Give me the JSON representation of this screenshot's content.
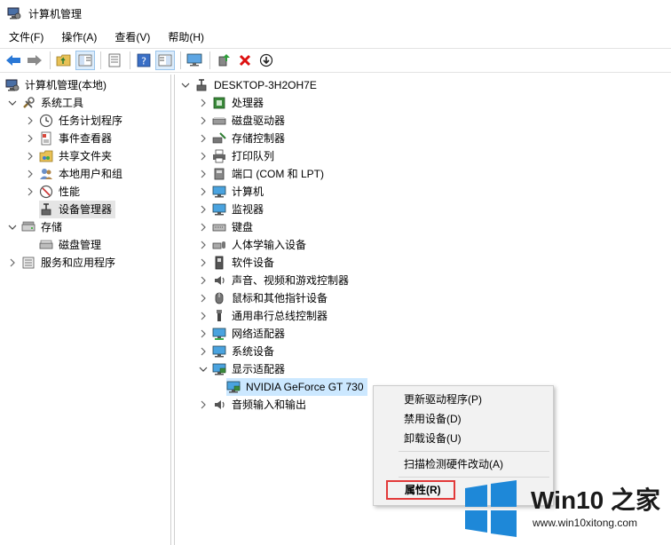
{
  "window": {
    "title": "计算机管理"
  },
  "menu": [
    "文件(F)",
    "操作(A)",
    "查看(V)",
    "帮助(H)"
  ],
  "toolbar_icons": [
    "back-arrow-icon",
    "forward-arrow-icon",
    "up-folder-icon",
    "show-tree-icon",
    "export-list-icon",
    "help-icon",
    "show-pane-icon",
    "monitor-icon",
    "update-driver-icon",
    "uninstall-x-icon",
    "disable-device-icon"
  ],
  "left_tree": {
    "root": "计算机管理(本地)",
    "system_tools": "系统工具",
    "task_scheduler": "任务计划程序",
    "event_viewer": "事件查看器",
    "shared_folders": "共享文件夹",
    "local_users": "本地用户和组",
    "performance": "性能",
    "device_manager": "设备管理器",
    "storage": "存储",
    "disk_management": "磁盘管理",
    "services_apps": "服务和应用程序"
  },
  "device_tree": {
    "computer_name": "DESKTOP-3H2OH7E",
    "categories": [
      "处理器",
      "磁盘驱动器",
      "存储控制器",
      "打印队列",
      "端口 (COM 和 LPT)",
      "计算机",
      "监视器",
      "键盘",
      "人体学输入设备",
      "软件设备",
      "声音、视频和游戏控制器",
      "鼠标和其他指针设备",
      "通用串行总线控制器",
      "网络适配器",
      "系统设备",
      "显示适配器"
    ],
    "display_adapter_child": "NVIDIA GeForce GT 730",
    "last_category": "音频输入和输出"
  },
  "context_menu": {
    "update_driver": "更新驱动程序(P)",
    "disable_device": "禁用设备(D)",
    "uninstall_device": "卸载设备(U)",
    "scan_hardware": "扫描检测硬件改动(A)",
    "properties": "属性(R)"
  },
  "watermark": {
    "title": "Win10 之家",
    "url": "www.win10xitong.com"
  },
  "colors": {
    "selection": "#cce8ff",
    "highlight_box": "#e23a3a",
    "win_logo": "#1e88d8"
  }
}
